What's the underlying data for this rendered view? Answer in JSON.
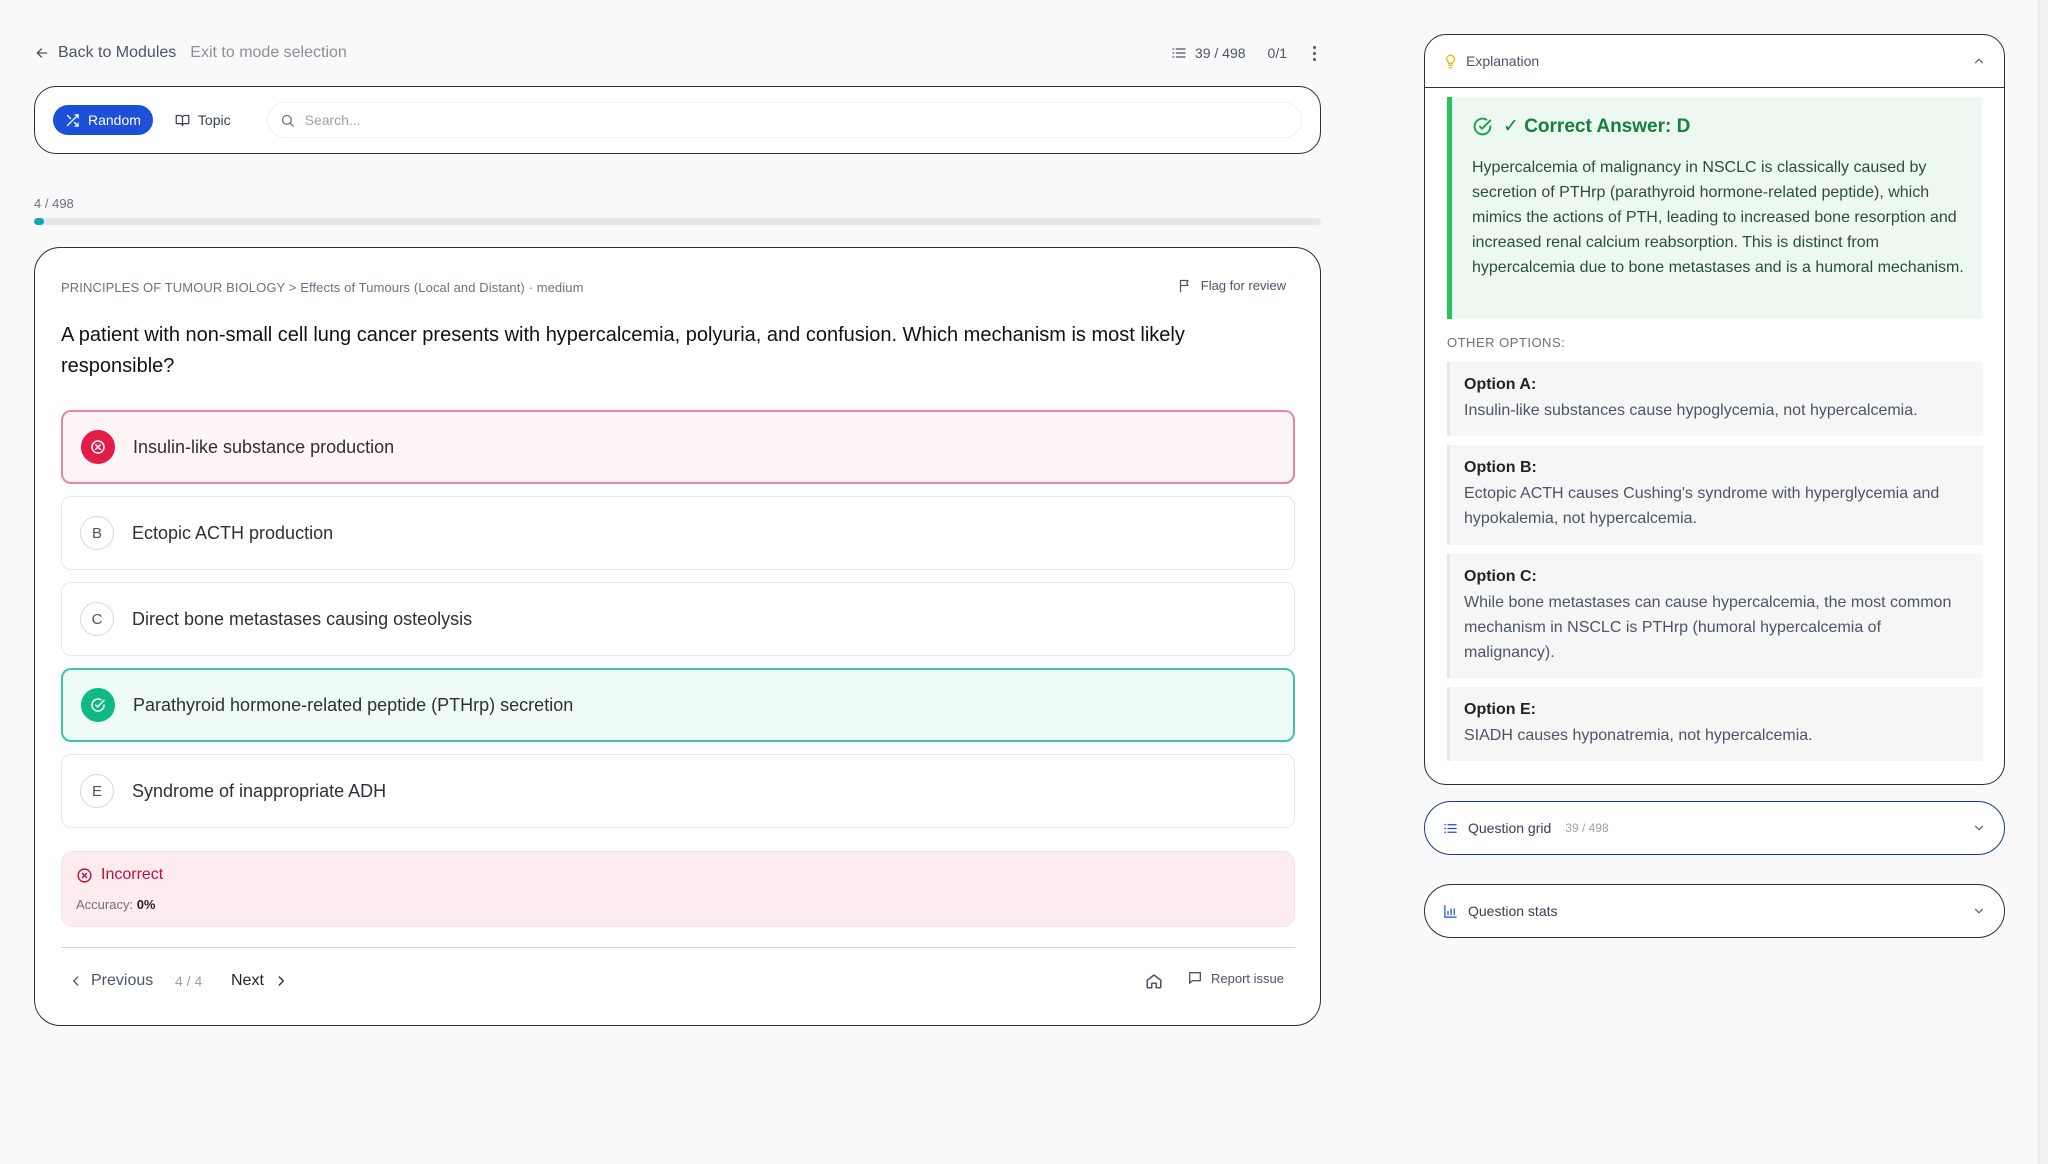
{
  "topbar": {
    "back_label": "Back to Modules",
    "exit_label": "Exit to mode selection",
    "counter": "39 / 498",
    "score": "0/1"
  },
  "modebar": {
    "random_label": "Random",
    "topic_label": "Topic",
    "search_placeholder": "Search..."
  },
  "progress": {
    "label": "4 / 498",
    "percent": 0.8
  },
  "question": {
    "meta": "PRINCIPLES OF TUMOUR BIOLOGY > Effects of Tumours (Local and Distant) · medium",
    "flag_label": "Flag for review",
    "text": "A patient with non-small cell lung cancer presents with hypercalcemia, polyuria, and confusion. Which mechanism is most likely responsible?",
    "options": [
      {
        "letter": "A",
        "text": "Insulin-like substance production",
        "state": "wrong"
      },
      {
        "letter": "B",
        "text": "Ectopic ACTH production",
        "state": "none"
      },
      {
        "letter": "C",
        "text": "Direct bone metastases causing osteolysis",
        "state": "none"
      },
      {
        "letter": "D",
        "text": "Parathyroid hormone-related peptide (PTHrp) secretion",
        "state": "right"
      },
      {
        "letter": "E",
        "text": "Syndrome of inappropriate ADH",
        "state": "none"
      }
    ],
    "result_title": "Incorrect",
    "accuracy_label": "Accuracy:",
    "accuracy_value": "0%"
  },
  "nav": {
    "prev_label": "Previous",
    "count": "4 / 4",
    "next_label": "Next",
    "report_label": "Report issue"
  },
  "explanation": {
    "header": "Explanation",
    "correct_title": "✓ Correct Answer: D",
    "correct_text": "Hypercalcemia of malignancy in NSCLC is classically caused by secretion of PTHrp (parathyroid hormone-related peptide), which mimics the actions of PTH, leading to increased bone resorption and increased renal calcium reabsorption. This is distinct from hypercalcemia due to bone metastases and is a humoral mechanism.",
    "other_label": "OTHER OPTIONS:",
    "others": [
      {
        "title": "Option A:",
        "text": "Insulin-like substances cause hypoglycemia, not hypercalcemia."
      },
      {
        "title": "Option B:",
        "text": "Ectopic ACTH causes Cushing's syndrome with hyperglycemia and hypokalemia, not hypercalcemia."
      },
      {
        "title": "Option C:",
        "text": "While bone metastases can cause hypercalcemia, the most common mechanism in NSCLC is PTHrp (humoral hypercalcemia of malignancy)."
      },
      {
        "title": "Option E:",
        "text": "SIADH causes hyponatremia, not hypercalcemia."
      }
    ]
  },
  "question_grid": {
    "label": "Question grid",
    "count": "39 / 498"
  },
  "question_stats": {
    "label": "Question stats"
  },
  "colors": {
    "accent": "#1d4fd8",
    "correct": "#10b981",
    "wrong": "#e11d48",
    "progress": "#0ea5b7"
  },
  "icons": {
    "back": "arrow-left-icon",
    "counter": "list-icon",
    "more": "kebab-icon",
    "random": "shuffle-icon",
    "topic": "book-icon",
    "search": "search-icon",
    "flag": "flag-icon",
    "wrong": "x-circle-icon",
    "right": "check-circle-icon",
    "home": "home-icon",
    "report": "message-icon",
    "explanation": "lightbulb-icon",
    "grid": "list-icon",
    "stats": "bar-chart-icon"
  }
}
